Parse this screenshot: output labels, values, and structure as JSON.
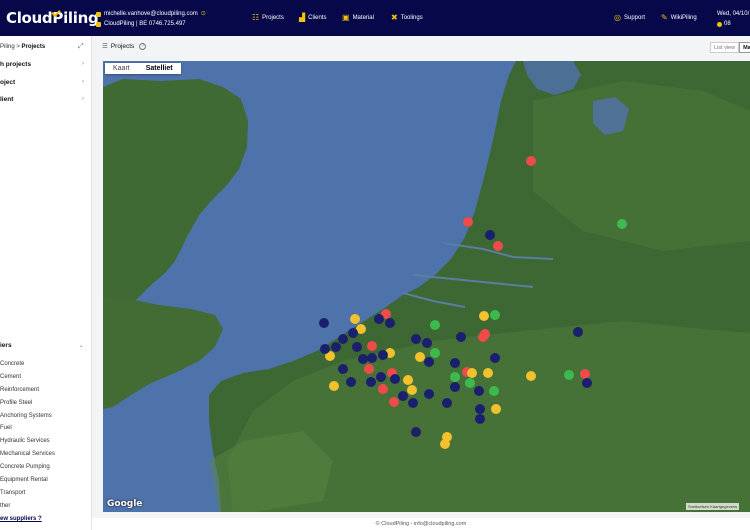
{
  "app": {
    "logo": "CloudPiling"
  },
  "user": {
    "email": "michelle.vanhove@cloudpiling.com",
    "company": "CloudPiling | BE 0746.725.497"
  },
  "nav": [
    {
      "label": "Projects",
      "icon": "grid-icon"
    },
    {
      "label": "Clients",
      "icon": "chart-icon"
    },
    {
      "label": "Material",
      "icon": "box-icon"
    },
    {
      "label": "Toolings",
      "icon": "tools-icon"
    }
  ],
  "support": {
    "label": "Support",
    "wiki": "WikiPiling"
  },
  "datetime": {
    "date": "Wed, 04/10/",
    "time": "08"
  },
  "sidebar": {
    "crumb_prefix": "Piling > ",
    "crumb_current": "Projects",
    "menu": [
      "h projects",
      "oject",
      "lient"
    ],
    "suppliers_header": "iers",
    "suppliers": [
      "Concrete",
      "Cement",
      "Reinforcement",
      "Profile Steel",
      "Anchoring Systems",
      "Fuel",
      "Hydraulic Services",
      "Mechanical Services",
      "Concrete Pumping",
      "Equipment Rental",
      "Transport",
      "ther"
    ],
    "new_suppliers": "ew suppliers ?"
  },
  "page": {
    "title": "Projects"
  },
  "view_toggle": {
    "list": "List view",
    "map": "Ma"
  },
  "map": {
    "types": [
      "Kaart",
      "Satelliet"
    ],
    "selected": "Satelliet",
    "google": "Google",
    "attribution": "Sneltoetsen   Kaartgegevens"
  },
  "colors": {
    "navy": "#06084a",
    "accent": "#f2c400",
    "pin_navy": "#1a1f6e",
    "pin_yellow": "#f2c12e",
    "pin_red": "#ef4b4b",
    "pin_green": "#3dba4e"
  },
  "footer": "© CloudPiling - info@cloudpiling.com"
}
